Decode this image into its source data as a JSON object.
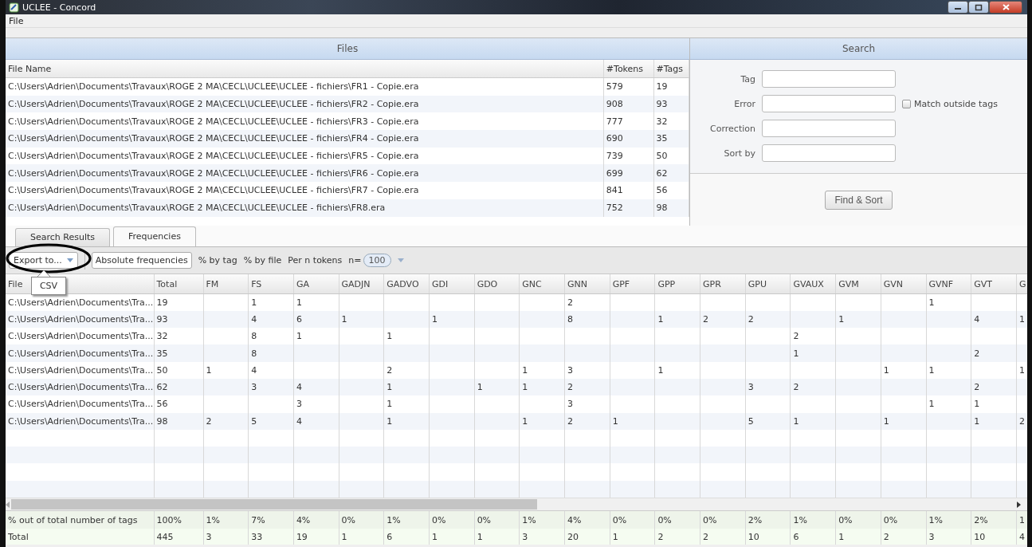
{
  "window": {
    "title": "UCLEE - Concord"
  },
  "menu": [
    {
      "label": "File"
    }
  ],
  "files": {
    "title": "Files",
    "columns": [
      "File Name",
      "#Tokens",
      "#Tags"
    ],
    "rows": [
      [
        "C:\\Users\\Adrien\\Documents\\Travaux\\ROGE 2 MA\\CECL\\UCLEE\\UCLEE - fichiers\\FR1 - Copie.era",
        "579",
        "19"
      ],
      [
        "C:\\Users\\Adrien\\Documents\\Travaux\\ROGE 2 MA\\CECL\\UCLEE\\UCLEE - fichiers\\FR2 - Copie.era",
        "908",
        "93"
      ],
      [
        "C:\\Users\\Adrien\\Documents\\Travaux\\ROGE 2 MA\\CECL\\UCLEE\\UCLEE - fichiers\\FR3 - Copie.era",
        "777",
        "32"
      ],
      [
        "C:\\Users\\Adrien\\Documents\\Travaux\\ROGE 2 MA\\CECL\\UCLEE\\UCLEE - fichiers\\FR4 - Copie.era",
        "690",
        "35"
      ],
      [
        "C:\\Users\\Adrien\\Documents\\Travaux\\ROGE 2 MA\\CECL\\UCLEE\\UCLEE - fichiers\\FR5 - Copie.era",
        "739",
        "50"
      ],
      [
        "C:\\Users\\Adrien\\Documents\\Travaux\\ROGE 2 MA\\CECL\\UCLEE\\UCLEE - fichiers\\FR6 - Copie.era",
        "699",
        "62"
      ],
      [
        "C:\\Users\\Adrien\\Documents\\Travaux\\ROGE 2 MA\\CECL\\UCLEE\\UCLEE - fichiers\\FR7 - Copie.era",
        "841",
        "56"
      ],
      [
        "C:\\Users\\Adrien\\Documents\\Travaux\\ROGE 2 MA\\CECL\\UCLEE\\UCLEE - fichiers\\FR8.era",
        "752",
        "98"
      ]
    ]
  },
  "search": {
    "title": "Search",
    "fields": [
      {
        "label": "Tag"
      },
      {
        "label": "Error"
      },
      {
        "label": "Correction"
      },
      {
        "label": "Sort by"
      }
    ],
    "match_outside_tags": {
      "label": "Match outside tags",
      "checked": false
    },
    "button": "Find & Sort"
  },
  "tabs": [
    {
      "label": "Search Results",
      "selected": false
    },
    {
      "label": "Frequencies",
      "selected": true
    }
  ],
  "toolbar": {
    "export": "Export to...",
    "modes": [
      {
        "label": "Absolute frequencies",
        "selected": true
      },
      {
        "label": "% by tag",
        "selected": false
      },
      {
        "label": "% by file",
        "selected": false
      },
      {
        "label": "Per n tokens",
        "selected": false
      }
    ],
    "n_label": "n=",
    "n_value": "100"
  },
  "export_menu": [
    {
      "label": "CSV"
    }
  ],
  "frequencies": {
    "columns": [
      "File",
      "Total",
      "FM",
      "FS",
      "GA",
      "GADJN",
      "GADVO",
      "GDI",
      "GDO",
      "GNC",
      "GNN",
      "GPF",
      "GPP",
      "GPR",
      "GPU",
      "GVAUX",
      "GVM",
      "GVN",
      "GVNF",
      "GVT",
      "G"
    ],
    "rows": [
      [
        "C:\\Users\\Adrien\\Documents\\Tra...",
        "19",
        "",
        "1",
        "1",
        "",
        "",
        "",
        "",
        "",
        "2",
        "",
        "",
        "",
        "",
        "",
        "",
        "",
        "1",
        "",
        ""
      ],
      [
        "C:\\Users\\Adrien\\Documents\\Tra...",
        "93",
        "",
        "4",
        "6",
        "1",
        "",
        "1",
        "",
        "",
        "8",
        "",
        "1",
        "2",
        "2",
        "",
        "1",
        "",
        "",
        "4",
        "1"
      ],
      [
        "C:\\Users\\Adrien\\Documents\\Tra...",
        "32",
        "",
        "8",
        "1",
        "",
        "1",
        "",
        "",
        "",
        "",
        "",
        "",
        "",
        "",
        "2",
        "",
        "",
        "",
        "",
        ""
      ],
      [
        "C:\\Users\\Adrien\\Documents\\Tra...",
        "35",
        "",
        "8",
        "",
        "",
        "",
        "",
        "",
        "",
        "",
        "",
        "",
        "",
        "",
        "1",
        "",
        "",
        "",
        "2",
        ""
      ],
      [
        "C:\\Users\\Adrien\\Documents\\Tra...",
        "50",
        "1",
        "4",
        "",
        "",
        "2",
        "",
        "",
        "1",
        "3",
        "",
        "1",
        "",
        "",
        "",
        "",
        "1",
        "1",
        "",
        "1"
      ],
      [
        "C:\\Users\\Adrien\\Documents\\Tra...",
        "62",
        "",
        "3",
        "4",
        "",
        "1",
        "",
        "1",
        "1",
        "2",
        "",
        "",
        "",
        "3",
        "2",
        "",
        "",
        "",
        "2",
        ""
      ],
      [
        "C:\\Users\\Adrien\\Documents\\Tra...",
        "56",
        "",
        "",
        "3",
        "",
        "1",
        "",
        "",
        "",
        "3",
        "",
        "",
        "",
        "",
        "",
        "",
        "",
        "1",
        "1",
        ""
      ],
      [
        "C:\\Users\\Adrien\\Documents\\Tra...",
        "98",
        "2",
        "5",
        "4",
        "",
        "1",
        "",
        "",
        "1",
        "2",
        "1",
        "",
        "",
        "5",
        "1",
        "",
        "1",
        "",
        "1",
        "2"
      ]
    ],
    "footer": [
      [
        "% out of total number of tags",
        "100%",
        "1%",
        "7%",
        "4%",
        "0%",
        "1%",
        "0%",
        "0%",
        "1%",
        "4%",
        "0%",
        "0%",
        "0%",
        "2%",
        "1%",
        "0%",
        "0%",
        "1%",
        "2%",
        "1"
      ],
      [
        "Total",
        "445",
        "3",
        "33",
        "19",
        "1",
        "6",
        "1",
        "1",
        "3",
        "20",
        "1",
        "2",
        "2",
        "10",
        "6",
        "1",
        "2",
        "3",
        "10",
        "4"
      ]
    ]
  }
}
